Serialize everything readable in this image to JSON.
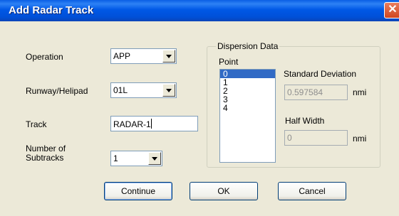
{
  "window": {
    "title": "Add Radar Track",
    "close_glyph": "✕"
  },
  "form": {
    "operation": {
      "label": "Operation",
      "value": "APP"
    },
    "runway": {
      "label": "Runway/Helipad",
      "value": "01L"
    },
    "track": {
      "label": "Track",
      "value": "RADAR-1"
    },
    "subtracks": {
      "label_line1": "Number of",
      "label_line2": "Subtracks",
      "value": "1"
    }
  },
  "dispersion": {
    "group_label": "Dispersion Data",
    "point_label": "Point",
    "points": [
      "0",
      "1",
      "2",
      "3",
      "4"
    ],
    "selected_point": "0",
    "std_dev_label": "Standard Deviation",
    "std_dev_value": "0.597584",
    "std_dev_unit": "nmi",
    "half_width_label": "Half Width",
    "half_width_value": "0",
    "half_width_unit": "nmi"
  },
  "buttons": {
    "continue": "Continue",
    "ok": "OK",
    "cancel": "Cancel"
  }
}
